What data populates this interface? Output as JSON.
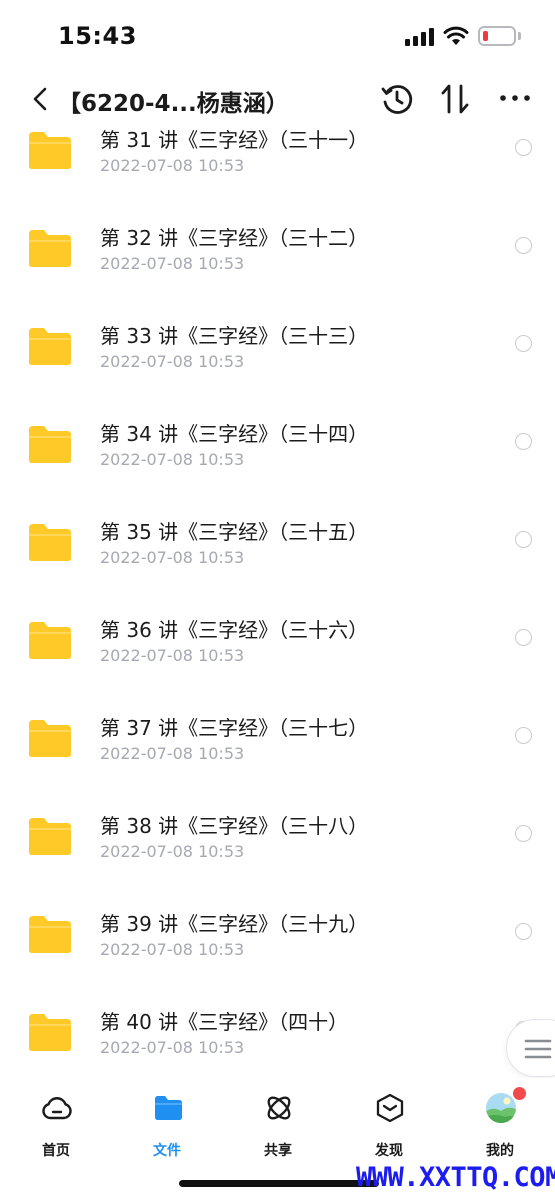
{
  "status_bar": {
    "time": "15:43",
    "battery_color": "#ef3b3b"
  },
  "nav": {
    "title": "【6220-4...杨惠涵）",
    "back_icon": "chevron-left-icon",
    "history_icon": "history-icon",
    "sort_icon": "sort-icon",
    "more_icon": "more-icon"
  },
  "files": [
    {
      "name": "第 31 讲《三字经》（三十一）",
      "date": "2022-07-08 10:53"
    },
    {
      "name": "第 32 讲《三字经》（三十二）",
      "date": "2022-07-08 10:53"
    },
    {
      "name": "第 33 讲《三字经》（三十三）",
      "date": "2022-07-08 10:53"
    },
    {
      "name": "第 34 讲《三字经》（三十四）",
      "date": "2022-07-08 10:53"
    },
    {
      "name": "第 35 讲《三字经》（三十五）",
      "date": "2022-07-08 10:53"
    },
    {
      "name": "第 36 讲《三字经》（三十六）",
      "date": "2022-07-08 10:53"
    },
    {
      "name": "第 37 讲《三字经》（三十七）",
      "date": "2022-07-08 10:53"
    },
    {
      "name": "第 38 讲《三字经》（三十八）",
      "date": "2022-07-08 10:53"
    },
    {
      "name": "第 39 讲《三字经》（三十九）",
      "date": "2022-07-08 10:53"
    },
    {
      "name": "第 40 讲《三字经》（四十）",
      "date": "2022-07-08 10:53"
    }
  ],
  "tabs": [
    {
      "label": "首页",
      "icon": "cloud-icon",
      "active": false
    },
    {
      "label": "文件",
      "icon": "folder-icon",
      "active": true
    },
    {
      "label": "共享",
      "icon": "share-orbit-icon",
      "active": false
    },
    {
      "label": "发现",
      "icon": "discover-box-icon",
      "active": false
    },
    {
      "label": "我的",
      "icon": "avatar-icon",
      "active": false
    }
  ],
  "colors": {
    "accent": "#1f8ff2",
    "folder": "#ffc928",
    "badge": "#f24b4b",
    "secondary_text": "#a7a9b2"
  },
  "watermark": "WWW.XXTTQ.COM"
}
